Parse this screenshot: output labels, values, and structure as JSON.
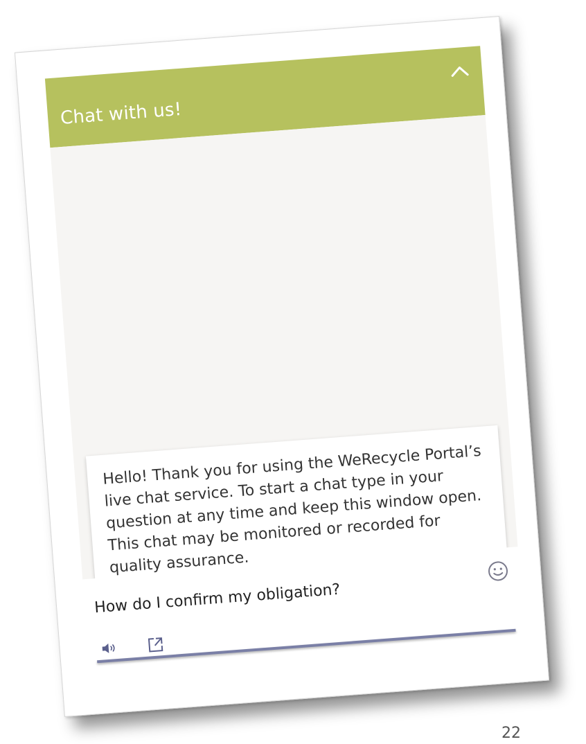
{
  "chat": {
    "title": "Chat with us!",
    "welcome_message": "Hello! Thank you for using the WeRecycle Portal’s live chat service. To start a chat type in your question at any time and keep this window open. This chat may be monitored or recorded for quality assurance.",
    "input_value": "How do I confirm my obligation?"
  },
  "page": {
    "number": "22"
  },
  "icons": {
    "collapse": "chevron-up-icon",
    "emoji": "smiley-icon",
    "sound": "speaker-icon",
    "popout": "popout-icon"
  },
  "colors": {
    "header": "#b6c15e",
    "body_background": "#f6f5f3",
    "underline": "#7a7fa6"
  }
}
